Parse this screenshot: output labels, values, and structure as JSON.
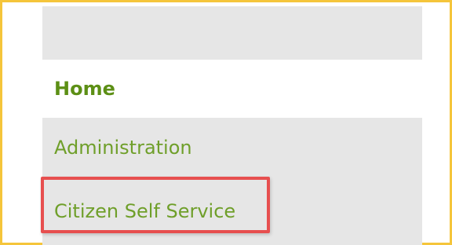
{
  "nav": {
    "items": [
      {
        "label": "Home",
        "active": true
      },
      {
        "label": "Administration",
        "active": false
      },
      {
        "label": "Citizen Self Service",
        "active": false
      }
    ]
  },
  "colors": {
    "frame_border": "#f5c53b",
    "nav_bg": "#e6e6e6",
    "link_green": "#6f9f2a",
    "active_green": "#5c8f15",
    "highlight_red": "#e74f4f"
  }
}
